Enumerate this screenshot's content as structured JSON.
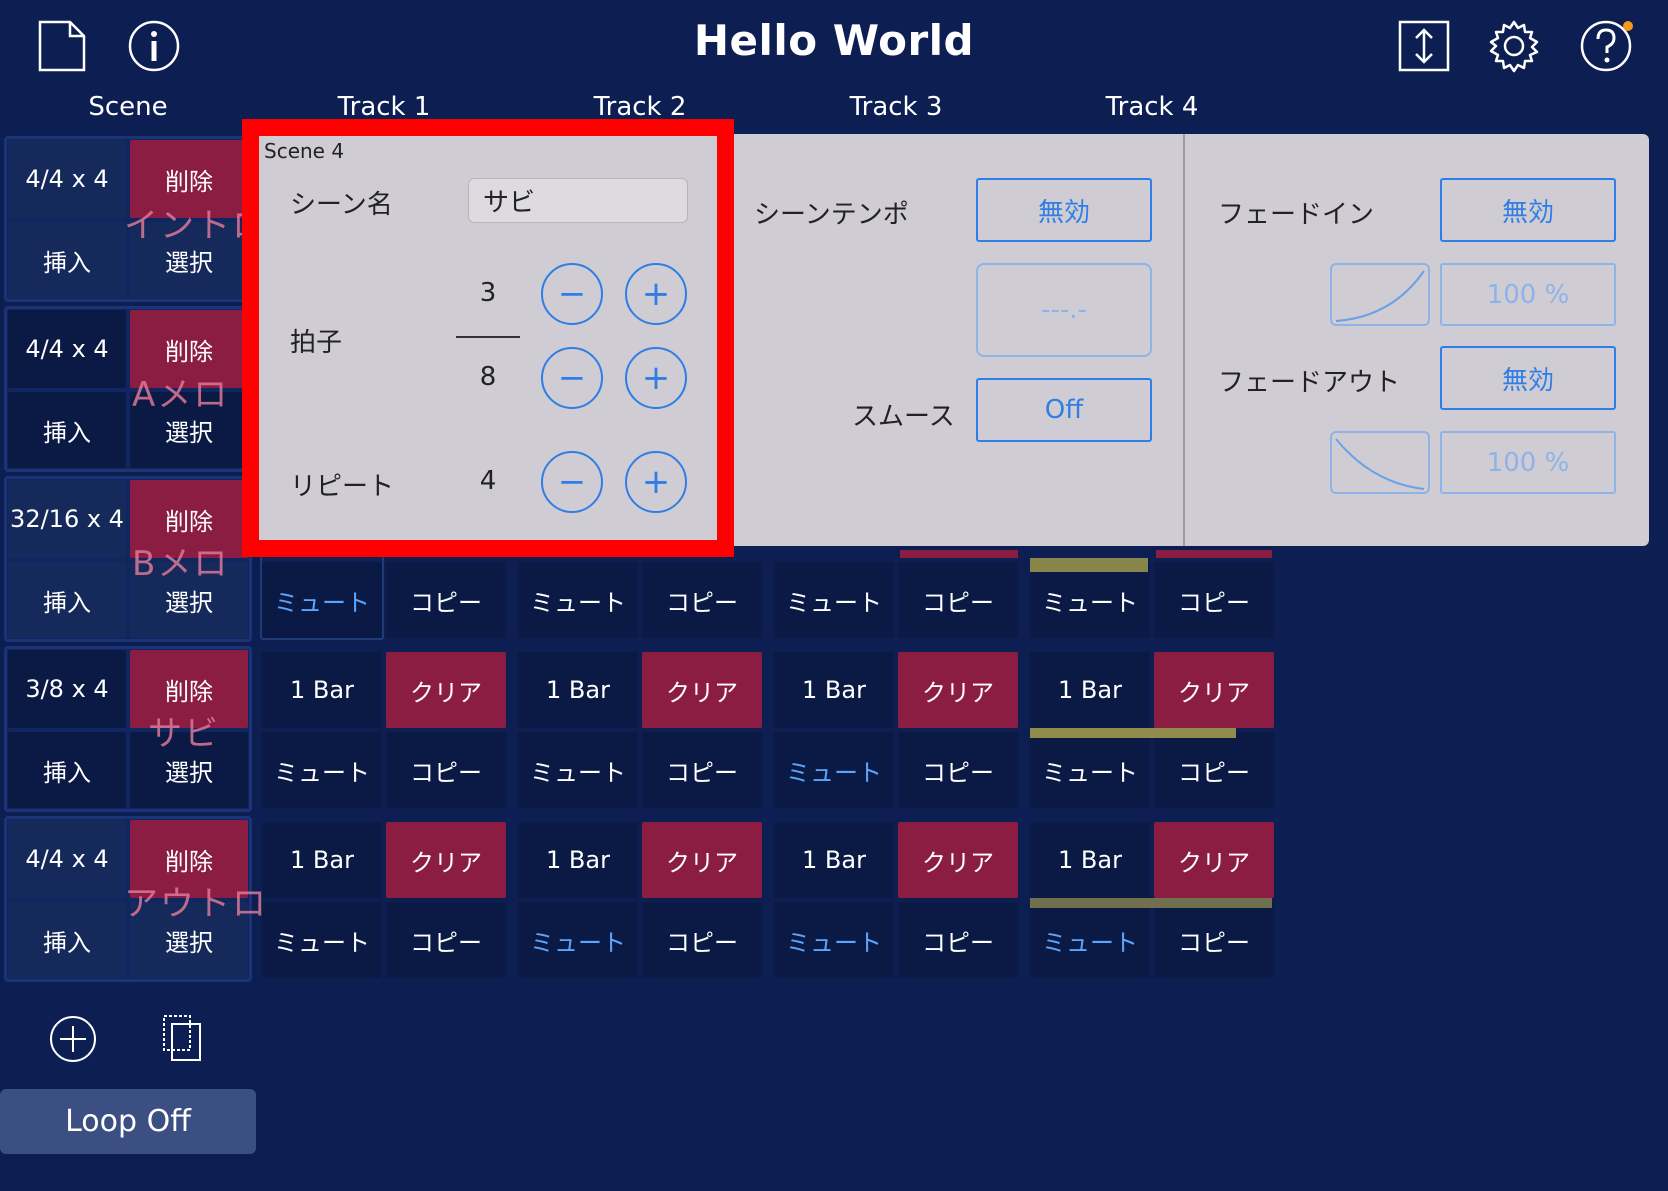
{
  "header": {
    "title": "Hello World"
  },
  "columns": [
    "Scene",
    "Track 1",
    "Track 2",
    "Track 3",
    "Track 4"
  ],
  "scenes": [
    {
      "sig": "4/4 x 4",
      "name": "イントロ"
    },
    {
      "sig": "4/4 x 4",
      "name": "Aメロ"
    },
    {
      "sig": "32/16 x 4",
      "name": "Bメロ"
    },
    {
      "sig": "3/8 x 4",
      "name": "サビ"
    },
    {
      "sig": "4/4 x 4",
      "name": "アウトロ"
    }
  ],
  "scene_buttons": {
    "delete": "削除",
    "insert": "挿入",
    "select": "選択"
  },
  "track_buttons": {
    "bar": "1 Bar",
    "clear": "クリア",
    "mute": "ミュート",
    "copy": "コピー"
  },
  "popup": {
    "scene_label": "Scene 4",
    "scene_name_label": "シーン名",
    "scene_name_value": "サビ",
    "time_sig_label": "拍子",
    "numerator": "3",
    "denominator": "8",
    "repeat_label": "リピート",
    "repeat_value": "4",
    "minus": "−",
    "plus": "+",
    "tempo_label": "シーンテンポ",
    "tempo_button": "無効",
    "tempo_value": "---.-",
    "smooth_label": "スムース",
    "smooth_button": "Off",
    "fade_in_label": "フェードイン",
    "fade_in_button": "無効",
    "fade_in_percent": "100 %",
    "fade_out_label": "フェードアウト",
    "fade_out_button": "無効",
    "fade_out_percent": "100 %"
  },
  "footer": {
    "loop_label": "Loop Off"
  },
  "colors": {
    "background": "#0c1e52",
    "accent_red": "#8c1d42",
    "panel": "#cfccd3",
    "button_blue": "#2f7ee6",
    "highlight": "#ff0000"
  }
}
